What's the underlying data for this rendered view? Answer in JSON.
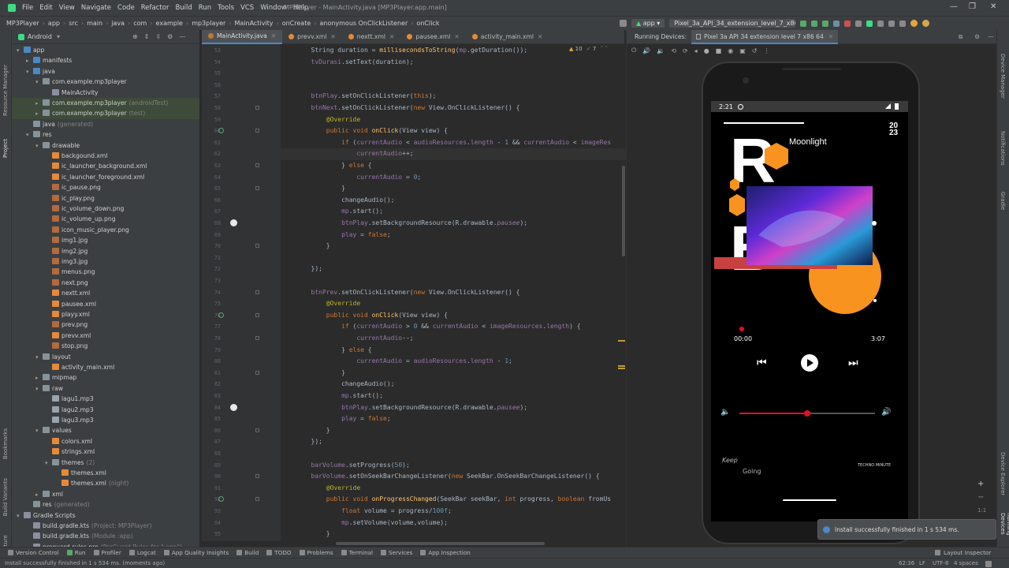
{
  "window": {
    "menu": [
      "File",
      "Edit",
      "View",
      "Navigate",
      "Code",
      "Refactor",
      "Build",
      "Run",
      "Tools",
      "VCS",
      "Window",
      "Help"
    ],
    "title": "MP3Player - MainActivity.java [MP3Player.app.main]"
  },
  "breadcrumb": [
    "MP3Player",
    "app",
    "src",
    "main",
    "java",
    "com",
    "example",
    "mp3player",
    "MainActivity",
    "onCreate",
    "anonymous OnClickListener",
    "onClick"
  ],
  "toolbar": {
    "config": "app",
    "device": "Pixel_3a_API_34_extension_level_7_x86"
  },
  "project": {
    "view": "Android",
    "tree": [
      {
        "label": "app",
        "depth": 0,
        "arrow": "▾",
        "icon": "fold blue"
      },
      {
        "label": "manifests",
        "depth": 1,
        "arrow": "▸",
        "icon": "fold blue"
      },
      {
        "label": "java",
        "depth": 1,
        "arrow": "▾",
        "icon": "fold blue"
      },
      {
        "label": "com.example.mp3player",
        "depth": 2,
        "arrow": "▾",
        "icon": "fold"
      },
      {
        "label": "MainActivity",
        "depth": 3,
        "arrow": "",
        "icon": "fkt"
      },
      {
        "label": "com.example.mp3player",
        "sub": "(androidTest)",
        "depth": 2,
        "arrow": "▸",
        "icon": "fold",
        "hl": true
      },
      {
        "label": "com.example.mp3player",
        "sub": "(test)",
        "depth": 2,
        "arrow": "▸",
        "icon": "fold",
        "hl": true
      },
      {
        "label": "java",
        "sub": "(generated)",
        "depth": 1,
        "arrow": "",
        "icon": "fold"
      },
      {
        "label": "res",
        "depth": 1,
        "arrow": "▾",
        "icon": "fold"
      },
      {
        "label": "drawable",
        "depth": 2,
        "arrow": "▾",
        "icon": "fold"
      },
      {
        "label": "backgound.xml",
        "depth": 3,
        "arrow": "",
        "icon": "fxml"
      },
      {
        "label": "ic_launcher_background.xml",
        "depth": 3,
        "arrow": "",
        "icon": "fxml"
      },
      {
        "label": "ic_launcher_foreground.xml",
        "depth": 3,
        "arrow": "",
        "icon": "fxml"
      },
      {
        "label": "ic_pause.png",
        "depth": 3,
        "arrow": "",
        "icon": "fpng"
      },
      {
        "label": "ic_play.png",
        "depth": 3,
        "arrow": "",
        "icon": "fpng"
      },
      {
        "label": "ic_volume_down.png",
        "depth": 3,
        "arrow": "",
        "icon": "fpng"
      },
      {
        "label": "ic_volume_up.png",
        "depth": 3,
        "arrow": "",
        "icon": "fpng"
      },
      {
        "label": "icon_music_player.png",
        "depth": 3,
        "arrow": "",
        "icon": "fpng"
      },
      {
        "label": "img1.jpg",
        "depth": 3,
        "arrow": "",
        "icon": "fpng"
      },
      {
        "label": "img2.jpg",
        "depth": 3,
        "arrow": "",
        "icon": "fpng"
      },
      {
        "label": "img3.jpg",
        "depth": 3,
        "arrow": "",
        "icon": "fpng"
      },
      {
        "label": "menus.png",
        "depth": 3,
        "arrow": "",
        "icon": "fpng"
      },
      {
        "label": "next.png",
        "depth": 3,
        "arrow": "",
        "icon": "fpng"
      },
      {
        "label": "nextt.xml",
        "depth": 3,
        "arrow": "",
        "icon": "fxml"
      },
      {
        "label": "pausee.xml",
        "depth": 3,
        "arrow": "",
        "icon": "fxml"
      },
      {
        "label": "playy.xml",
        "depth": 3,
        "arrow": "",
        "icon": "fxml"
      },
      {
        "label": "prev.png",
        "depth": 3,
        "arrow": "",
        "icon": "fpng"
      },
      {
        "label": "prevv.xml",
        "depth": 3,
        "arrow": "",
        "icon": "fxml"
      },
      {
        "label": "stop.png",
        "depth": 3,
        "arrow": "",
        "icon": "fpng"
      },
      {
        "label": "layout",
        "depth": 2,
        "arrow": "▾",
        "icon": "fold"
      },
      {
        "label": "activity_main.xml",
        "depth": 3,
        "arrow": "",
        "icon": "fxml"
      },
      {
        "label": "mipmap",
        "depth": 2,
        "arrow": "▸",
        "icon": "fold"
      },
      {
        "label": "raw",
        "depth": 2,
        "arrow": "▾",
        "icon": "fold"
      },
      {
        "label": "lagu1.mp3",
        "depth": 3,
        "arrow": "",
        "icon": "fmp3"
      },
      {
        "label": "lagu2.mp3",
        "depth": 3,
        "arrow": "",
        "icon": "fmp3"
      },
      {
        "label": "lagu3.mp3",
        "depth": 3,
        "arrow": "",
        "icon": "fmp3"
      },
      {
        "label": "values",
        "depth": 2,
        "arrow": "▾",
        "icon": "fold"
      },
      {
        "label": "colors.xml",
        "depth": 3,
        "arrow": "",
        "icon": "fxml"
      },
      {
        "label": "strings.xml",
        "depth": 3,
        "arrow": "",
        "icon": "fxml"
      },
      {
        "label": "themes",
        "sub": "(2)",
        "depth": 3,
        "arrow": "▾",
        "icon": "fold"
      },
      {
        "label": "themes.xml",
        "depth": 4,
        "arrow": "",
        "icon": "fxml"
      },
      {
        "label": "themes.xml",
        "sub": "(night)",
        "depth": 4,
        "arrow": "",
        "icon": "fxml"
      },
      {
        "label": "xml",
        "depth": 2,
        "arrow": "▸",
        "icon": "fold"
      },
      {
        "label": "res",
        "sub": "(generated)",
        "depth": 1,
        "arrow": "",
        "icon": "fold"
      },
      {
        "label": "Gradle Scripts",
        "depth": 0,
        "arrow": "▾",
        "icon": "fkt"
      },
      {
        "label": "build.gradle.kts",
        "sub": "(Project: MP3Player)",
        "depth": 1,
        "arrow": "",
        "icon": "fkt"
      },
      {
        "label": "build.gradle.kts",
        "sub": "(Module :app)",
        "depth": 1,
        "arrow": "",
        "icon": "fkt"
      },
      {
        "label": "proguard-rules.pro",
        "sub": "(ProGuard Rules for \":app\")",
        "depth": 1,
        "arrow": "",
        "icon": "fkt"
      }
    ]
  },
  "tabs": [
    {
      "label": "MainActivity.java",
      "active": true,
      "color": "#c57633"
    },
    {
      "label": "prevv.xml",
      "active": false,
      "color": "#e5893a"
    },
    {
      "label": "nextt.xml",
      "active": false,
      "color": "#e5893a"
    },
    {
      "label": "pausee.xml",
      "active": false,
      "color": "#e5893a"
    },
    {
      "label": "activity_main.xml",
      "active": false,
      "color": "#e5893a"
    }
  ],
  "inspection": {
    "warnings": "10",
    "ok": "7"
  },
  "code": [
    {
      "n": "53",
      "html": "        String duration = <span class='fn'>millisecondsToString</span>(<span class='fld'>mp</span>.getDuration());"
    },
    {
      "n": "54",
      "html": "        <span class='fld'>tvDurasi</span>.setText(duration);"
    },
    {
      "n": "55",
      "html": ""
    },
    {
      "n": "56",
      "html": ""
    },
    {
      "n": "57",
      "html": "        <span class='fld'>btnPlay</span>.setOnClickListener(<span class='kw'>this</span>);"
    },
    {
      "n": "58",
      "html": "        <span class='fld'>btnNext</span>.setOnClickListener(<span class='kw'>new</span> View.OnClickListener() {"
    },
    {
      "n": "59",
      "html": "            <span class='ann'>@Override</span>"
    },
    {
      "n": "60",
      "html": "            <span class='kw'>public void</span> <span class='fn'>onClick</span>(View view) {"
    },
    {
      "n": "61",
      "html": "                <span class='kw'>if</span> (<span class='fld'>currentAudio</span> &lt; <span class='fld'>audioResources</span>.<span class='fld'>length</span> - <span class='num'>1</span> &amp;&amp; <span class='fld'>currentAudio</span> &lt; <span class='fld'>imageRes</span>"
    },
    {
      "n": "62",
      "html": "                    <span class='fld'>currentAudio</span>++;"
    },
    {
      "n": "63",
      "html": "                } <span class='kw'>else</span> {"
    },
    {
      "n": "64",
      "html": "                    <span class='fld'>currentAudio</span> = <span class='num'>0</span>;"
    },
    {
      "n": "65",
      "html": "                }"
    },
    {
      "n": "66",
      "html": "                changeAudio();"
    },
    {
      "n": "67",
      "html": "                <span class='fld'>mp</span>.start();"
    },
    {
      "n": "68",
      "html": "                <span class='fld'>btnPlay</span>.setBackgroundResource(R.drawable.<span class='itl'>pausee</span>);"
    },
    {
      "n": "69",
      "html": "                <span class='fld'>play</span> = <span class='kw'>false</span>;"
    },
    {
      "n": "70",
      "html": "            }"
    },
    {
      "n": "71",
      "html": ""
    },
    {
      "n": "72",
      "html": "        });"
    },
    {
      "n": "73",
      "html": ""
    },
    {
      "n": "74",
      "html": "        <span class='fld'>btnPrev</span>.setOnClickListener(<span class='kw'>new</span> View.OnClickListener() {"
    },
    {
      "n": "75",
      "html": "            <span class='ann'>@Override</span>"
    },
    {
      "n": "76",
      "html": "            <span class='kw'>public void</span> <span class='fn'>onClick</span>(View view) {"
    },
    {
      "n": "77",
      "html": "                <span class='kw'>if</span> (<span class='fld'>currentAudio</span> &gt; <span class='num'>0</span> &amp;&amp; <span class='fld'>currentAudio</span> &lt; <span class='fld'>imageResources</span>.<span class='fld'>length</span>) {"
    },
    {
      "n": "78",
      "html": "                    <span class='fld'>currentAudio</span>--;"
    },
    {
      "n": "79",
      "html": "                } <span class='kw'>else</span> {"
    },
    {
      "n": "80",
      "html": "                    <span class='fld'>currentAudio</span> = <span class='fld'>audioResources</span>.<span class='fld'>length</span> - <span class='num'>1</span>;"
    },
    {
      "n": "81",
      "html": "                }"
    },
    {
      "n": "82",
      "html": "                changeAudio();"
    },
    {
      "n": "83",
      "html": "                <span class='fld'>mp</span>.start();"
    },
    {
      "n": "84",
      "html": "                <span class='fld'>btnPlay</span>.setBackgroundResource(R.drawable.<span class='itl'>pausee</span>);"
    },
    {
      "n": "85",
      "html": "                <span class='fld'>play</span> = <span class='kw'>false</span>;"
    },
    {
      "n": "86",
      "html": "            }"
    },
    {
      "n": "87",
      "html": "        });"
    },
    {
      "n": "88",
      "html": ""
    },
    {
      "n": "89",
      "html": "        <span class='fld'>barVolume</span>.setProgress(<span class='num'>50</span>);"
    },
    {
      "n": "90",
      "html": "        <span class='fld'>barVolume</span>.setOnSeekBarChangeListener(<span class='kw'>new</span> SeekBar.OnSeekBarChangeListener() {"
    },
    {
      "n": "91",
      "html": "            <span class='ann'>@Override</span>"
    },
    {
      "n": "92",
      "html": "            <span class='kw'>public void</span> <span class='fn'>onProgressChanged</span>(SeekBar seekBar, <span class='kw'>int</span> progress, <span class='kw'>boolean</span> fromUs"
    },
    {
      "n": "93",
      "html": "                <span class='kw'>float</span> volume = progress/<span class='num'>100f</span>;"
    },
    {
      "n": "94",
      "html": "                <span class='fld'>mp</span>.setVolume(volume,volume);"
    },
    {
      "n": "95",
      "html": "            }"
    }
  ],
  "run": {
    "label": "Running Devices:",
    "device_tab": "Pixel 3a API 34 extension level 7 x86 64"
  },
  "phone": {
    "time": "2:21",
    "year_top": "20",
    "year_bottom": "23",
    "song_title": "Moonlight",
    "elapsed": "00:00",
    "duration": "3:07",
    "volume_progress": 0.5,
    "bottom_left_1": "Keep",
    "bottom_left_2": "Going",
    "bottom_right": "TECHNO MINUTE",
    "logo_letters": [
      "R",
      "B"
    ]
  },
  "toast": "Install successfully finished in 1 s 534 ms.",
  "bottom_tools": [
    "Version Control",
    "Run",
    "Profiler",
    "Logcat",
    "App Quality Insights",
    "Build",
    "TODO",
    "Problems",
    "Terminal",
    "Services",
    "App Inspection"
  ],
  "layout_inspector": "Layout Inspector",
  "status": {
    "message": "Install successfully finished in 1 s 534 ms. (moments ago)",
    "position": "62:36",
    "line_sep": "LF",
    "encoding": "UTF-8",
    "indent": "4 spaces"
  },
  "left_strip": [
    "Resource Manager",
    "Project",
    "Bookmarks",
    "Build Variants",
    "Structure"
  ],
  "right_strip": [
    "Device Manager",
    "Notifications",
    "Gradle",
    "Device Explorer",
    "Running Devices"
  ]
}
